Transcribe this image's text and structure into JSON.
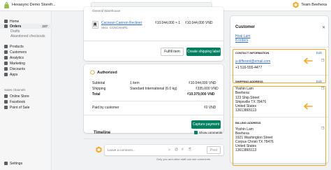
{
  "topbar": {
    "store_name": "Hexasync Demo Storefr...",
    "team_name": "Team Beehexa"
  },
  "sidebar": {
    "items": [
      {
        "label": "Home"
      },
      {
        "label": "Orders",
        "badge": "237"
      },
      {
        "label": "Drafts"
      },
      {
        "label": "Abandoned checkouts"
      },
      {
        "label": "Products"
      },
      {
        "label": "Customers"
      },
      {
        "label": "Analytics"
      },
      {
        "label": "Marketing"
      },
      {
        "label": "Discounts"
      },
      {
        "label": "Apps"
      }
    ],
    "channels_label": "Sales channels",
    "channels": [
      {
        "label": "Online Store"
      },
      {
        "label": "Facebook"
      },
      {
        "label": "Point of Sale"
      }
    ],
    "settings_label": "Settings"
  },
  "fulfillment": {
    "header_text": "General Warehouse",
    "product_name": "Cacsean Cannon Recliner",
    "sku": "SKU: CCNCHAIR1",
    "unit_price": "₫10.044,000 × 1",
    "line_total": "₫10.044,000 VND",
    "fulfill_button": "Fulfill item",
    "create_label_button": "Create shipping label"
  },
  "payment": {
    "status": "Authorized",
    "rows": [
      {
        "label": "Subtotal",
        "mid": "1 item",
        "value": "₫10.044,000 VND"
      },
      {
        "label": "Shipping",
        "mid": "Standard International (6.0 kg)",
        "value": "₫335,000 VND"
      },
      {
        "label": "Total",
        "mid": "",
        "value": "₫10.379,000 VND"
      }
    ],
    "paid_label": "Paid by customer",
    "paid_value": "₫0 VND",
    "capture_button": "Capture payment"
  },
  "timeline": {
    "title": "Timeline",
    "show_comments": "Show comments",
    "comment_placeholder": "Leave a comment...",
    "post_button": "Post",
    "note": "Only you and other staff can see comments"
  },
  "customer": {
    "title": "Customer",
    "name": "Hoai Lam",
    "orders": "8 orders",
    "contact_title": "CONTACT INFORMATION",
    "contact_edit": "Edit",
    "email": "a-different@email.com",
    "phone": "+1 516-555-4477",
    "shipping_title": "SHIPPING ADDRESS",
    "shipping_edit": "Edit",
    "shipping_lines": [
      "Yoshin Lam",
      "Beehexa",
      "123 Ship Street",
      "Shipsville TX 78476",
      "United States",
      "13613865113"
    ],
    "billing_title": "BILLING ADDRESS",
    "billing_lines": [
      "Yoshin Lam",
      "Beehexa",
      "1921 Washington Street",
      "Corpus Christi TX 78476",
      "United States",
      "13613865113"
    ]
  },
  "colors": {
    "highlight": "#f5a623",
    "primary": "#008060",
    "link": "#2c6ecb"
  }
}
